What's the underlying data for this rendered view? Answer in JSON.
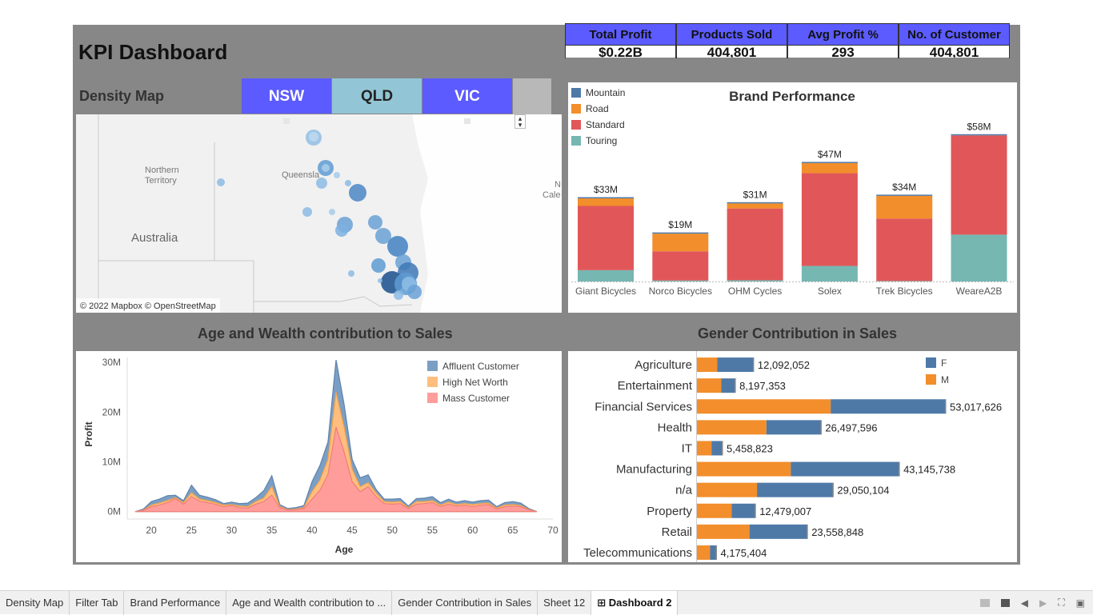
{
  "title": "KPI Dashboard",
  "kpis": [
    {
      "label": "Total Profit",
      "value": "$0.22B"
    },
    {
      "label": "Products Sold",
      "value": "404,801"
    },
    {
      "label": "Avg Profit %",
      "value": "293"
    },
    {
      "label": "No. of Customer",
      "value": "404,801"
    }
  ],
  "map": {
    "title": "Density Map",
    "states": [
      {
        "label": "NSW",
        "color": "#5b5bff"
      },
      {
        "label": "QLD",
        "color": "#92c5d5"
      },
      {
        "label": "VIC",
        "color": "#5b5bff"
      }
    ],
    "labels": {
      "nt": "Northern",
      "nt2": "Territory",
      "qld": "Queensla",
      "country": "Australia",
      "nc": "N",
      "nc2": "Cale"
    },
    "attribution": "© 2022 Mapbox © OpenStreetMap"
  },
  "chart_data": [
    {
      "type": "bar",
      "title": "Brand Performance",
      "stacked": true,
      "categories": [
        "Giant Bicycles",
        "Norco Bicycles",
        "OHM Cycles",
        "Solex",
        "Trek Bicycles",
        "WeareA2B"
      ],
      "totals_labels": [
        "$33M",
        "$19M",
        "$31M",
        "$47M",
        "$34M",
        "$58M"
      ],
      "series": [
        {
          "name": "Mountain",
          "color": "#4e79a7",
          "values": [
            0,
            0,
            0,
            0,
            0,
            0
          ]
        },
        {
          "name": "Road",
          "color": "#f28e2b",
          "values": [
            3,
            7,
            2,
            4,
            9,
            0
          ]
        },
        {
          "name": "Standard",
          "color": "#e15759",
          "values": [
            25.5,
            11.6,
            28.5,
            36.8,
            24.8,
            39.4
          ]
        },
        {
          "name": "Touring",
          "color": "#76b7b2",
          "values": [
            4.5,
            0.4,
            0.5,
            6.2,
            0.2,
            18.6
          ]
        }
      ],
      "legend_position": "top-left"
    },
    {
      "type": "area",
      "title": "Age and Wealth contribution to Sales",
      "xlabel": "Age",
      "ylabel": "Profit",
      "xticks": [
        20,
        25,
        30,
        35,
        40,
        45,
        50,
        55,
        60,
        65,
        70
      ],
      "yticks": [
        {
          "v": 0,
          "label": "0M"
        },
        {
          "v": 10,
          "label": "10M"
        },
        {
          "v": 20,
          "label": "20M"
        },
        {
          "v": 30,
          "label": "30M"
        }
      ],
      "xlim": [
        17,
        70
      ],
      "ylim": [
        -1.5,
        31
      ],
      "x": [
        18,
        19,
        20,
        21,
        22,
        23,
        24,
        25,
        26,
        27,
        28,
        29,
        30,
        31,
        32,
        33,
        34,
        35,
        36,
        37,
        38,
        39,
        40,
        41,
        42,
        43,
        44,
        45,
        46,
        47,
        48,
        49,
        50,
        51,
        52,
        53,
        54,
        55,
        56,
        57,
        58,
        59,
        60,
        61,
        62,
        63,
        64,
        65,
        66,
        67,
        68
      ],
      "series": [
        {
          "name": "Mass Customer",
          "color": "#ff9d9a",
          "values": [
            0,
            0.2,
            1.0,
            1.3,
            1.8,
            2.6,
            1.5,
            3.0,
            2.1,
            1.8,
            1.5,
            1.0,
            1.2,
            0.8,
            0.7,
            1.5,
            2.0,
            3.3,
            0.8,
            0.3,
            0.4,
            0.6,
            2.5,
            4.3,
            7.5,
            17.0,
            12.0,
            6.0,
            4.0,
            5.0,
            3.0,
            1.6,
            1.5,
            1.6,
            0.6,
            1.5,
            1.6,
            1.8,
            1.0,
            1.5,
            1.1,
            1.3,
            1.0,
            1.3,
            1.4,
            0.5,
            1.0,
            1.1,
            1.0,
            0.3,
            0
          ]
        },
        {
          "name": "High Net Worth",
          "color": "#ffbe7d",
          "values": [
            0,
            0.1,
            0.3,
            0.4,
            0.4,
            0.2,
            0.3,
            0.8,
            0.4,
            0.4,
            0.3,
            0.3,
            0.2,
            0.3,
            0.3,
            0.5,
            0.7,
            1.7,
            0.2,
            0.1,
            0.1,
            0.2,
            1.5,
            2.0,
            3.0,
            7.0,
            5.0,
            2.5,
            1.0,
            0.8,
            0.7,
            0.4,
            0.4,
            0.4,
            0.2,
            0.5,
            0.4,
            0.4,
            0.3,
            0.4,
            0.3,
            0.3,
            0.4,
            0.3,
            0.3,
            0.2,
            0.3,
            0.3,
            0.2,
            0.1,
            0
          ]
        },
        {
          "name": "Affluent Customer",
          "color": "#7b9fc4",
          "values": [
            0,
            0.2,
            0.7,
            0.8,
            1.0,
            0.5,
            0.4,
            1.5,
            0.8,
            0.7,
            0.6,
            0.3,
            0.5,
            0.5,
            0.7,
            0.8,
            1.5,
            2.2,
            0.4,
            0.2,
            0.3,
            0.4,
            2.0,
            3.0,
            3.5,
            6.5,
            4.6,
            2.0,
            1.8,
            1.6,
            0.7,
            0.5,
            0.6,
            0.6,
            0.3,
            0.6,
            0.7,
            0.8,
            0.5,
            0.6,
            0.5,
            0.6,
            0.5,
            0.6,
            0.6,
            0.3,
            0.5,
            0.6,
            0.5,
            0.2,
            0
          ]
        }
      ],
      "legend_position": "top-right"
    },
    {
      "type": "bar",
      "orientation": "horizontal",
      "title": "Gender Contribution in Sales",
      "stacked": true,
      "categories": [
        "Agriculture",
        "Entertainment",
        "Financial Services",
        "Health",
        "IT",
        "Manufacturing",
        "n/a",
        "Property",
        "Retail",
        "Telecommunications"
      ],
      "totals": [
        12092052,
        8197353,
        53017626,
        26497596,
        5458823,
        43145738,
        29050104,
        12479007,
        23558848,
        4175404
      ],
      "total_labels": [
        "12,092,052",
        "8,197,353",
        "53,017,626",
        "26,497,596",
        "5,458,823",
        "43,145,738",
        "29,050,104",
        "12,479,007",
        "23,558,848",
        "4,175,404"
      ],
      "series": [
        {
          "name": "M",
          "color": "#f28e2b",
          "values": [
            4300000,
            5200000,
            28500000,
            14800000,
            3100000,
            20000000,
            12800000,
            7400000,
            11200000,
            2800000
          ]
        },
        {
          "name": "F",
          "color": "#4e79a7",
          "values": [
            7792052,
            2997353,
            24517626,
            11697596,
            2358823,
            23145738,
            16250104,
            5079007,
            12358848,
            1375404
          ]
        }
      ],
      "legend_labels": [
        "F",
        "M"
      ],
      "legend_position": "top-right"
    }
  ],
  "tabs": [
    {
      "label": "Density Map",
      "active": false
    },
    {
      "label": "Filter Tab",
      "active": false
    },
    {
      "label": "Brand Performance",
      "active": false
    },
    {
      "label": "Age and Wealth contribution to ...",
      "active": false
    },
    {
      "label": "Gender Contribution in Sales",
      "active": false
    },
    {
      "label": "Sheet 12",
      "active": false
    },
    {
      "label": "Dashboard 2",
      "active": true
    }
  ],
  "tab_icons": [
    "grid-view-icon",
    "single-view-icon",
    "prev-icon",
    "next-icon",
    "fullscreen-icon",
    "present-icon"
  ]
}
